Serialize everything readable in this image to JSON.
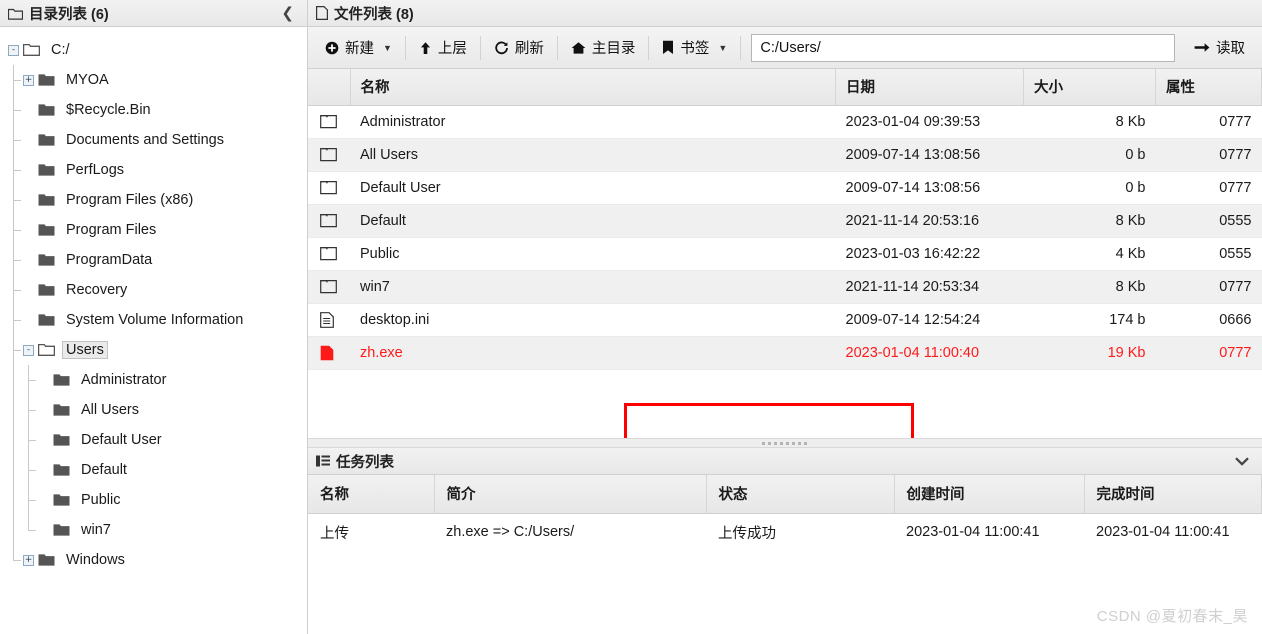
{
  "sidebar": {
    "header": {
      "icon": "folder-outline-icon",
      "title": "目录列表 (6)",
      "collapse_label": "❮"
    },
    "tree": [
      {
        "label": "C:/",
        "depth": 0,
        "toggle": "-",
        "folder": "open",
        "selected": false
      },
      {
        "label": "MYOA",
        "depth": 1,
        "toggle": "+",
        "folder": "closed",
        "selected": false
      },
      {
        "label": "$Recycle.Bin",
        "depth": 1,
        "toggle": "",
        "folder": "closed",
        "selected": false
      },
      {
        "label": "Documents and Settings",
        "depth": 1,
        "toggle": "",
        "folder": "closed",
        "selected": false
      },
      {
        "label": "PerfLogs",
        "depth": 1,
        "toggle": "",
        "folder": "closed",
        "selected": false
      },
      {
        "label": "Program Files (x86)",
        "depth": 1,
        "toggle": "",
        "folder": "closed",
        "selected": false
      },
      {
        "label": "Program Files",
        "depth": 1,
        "toggle": "",
        "folder": "closed",
        "selected": false
      },
      {
        "label": "ProgramData",
        "depth": 1,
        "toggle": "",
        "folder": "closed",
        "selected": false
      },
      {
        "label": "Recovery",
        "depth": 1,
        "toggle": "",
        "folder": "closed",
        "selected": false
      },
      {
        "label": "System Volume Information",
        "depth": 1,
        "toggle": "",
        "folder": "closed",
        "selected": false
      },
      {
        "label": "Users",
        "depth": 1,
        "toggle": "-",
        "folder": "open",
        "selected": true
      },
      {
        "label": "Administrator",
        "depth": 2,
        "toggle": "",
        "folder": "closed",
        "selected": false
      },
      {
        "label": "All Users",
        "depth": 2,
        "toggle": "",
        "folder": "closed",
        "selected": false
      },
      {
        "label": "Default User",
        "depth": 2,
        "toggle": "",
        "folder": "closed",
        "selected": false
      },
      {
        "label": "Default",
        "depth": 2,
        "toggle": "",
        "folder": "closed",
        "selected": false
      },
      {
        "label": "Public",
        "depth": 2,
        "toggle": "",
        "folder": "closed",
        "selected": false
      },
      {
        "label": "win7",
        "depth": 2,
        "toggle": "",
        "folder": "closed",
        "selected": false
      },
      {
        "label": "Windows",
        "depth": 1,
        "toggle": "+",
        "folder": "closed",
        "selected": false
      }
    ]
  },
  "filepanel": {
    "header": {
      "icon": "file-outline-icon",
      "title": "文件列表 (8)"
    },
    "toolbar": {
      "new_label": "新建",
      "up_label": "上层",
      "refresh_label": "刷新",
      "home_label": "主目录",
      "bookmark_label": "书签",
      "read_label": "读取",
      "address_value": "C:/Users/",
      "address_placeholder": "C:/"
    },
    "columns": [
      "名称",
      "日期",
      "大小",
      "属性"
    ],
    "rows": [
      {
        "icon": "folder-icon",
        "name": "Administrator",
        "date": "2023-01-04 09:39:53",
        "size": "8 Kb",
        "attr": "0777",
        "highlight": false
      },
      {
        "icon": "folder-icon",
        "name": "All Users",
        "date": "2009-07-14 13:08:56",
        "size": "0 b",
        "attr": "0777",
        "highlight": false
      },
      {
        "icon": "folder-icon",
        "name": "Default User",
        "date": "2009-07-14 13:08:56",
        "size": "0 b",
        "attr": "0777",
        "highlight": false
      },
      {
        "icon": "folder-icon",
        "name": "Default",
        "date": "2021-11-14 20:53:16",
        "size": "8 Kb",
        "attr": "0555",
        "highlight": false
      },
      {
        "icon": "folder-icon",
        "name": "Public",
        "date": "2023-01-03 16:42:22",
        "size": "4 Kb",
        "attr": "0555",
        "highlight": false
      },
      {
        "icon": "folder-icon",
        "name": "win7",
        "date": "2021-11-14 20:53:34",
        "size": "8 Kb",
        "attr": "0777",
        "highlight": false
      },
      {
        "icon": "file-icon",
        "name": "desktop.ini",
        "date": "2009-07-14 12:54:24",
        "size": "174 b",
        "attr": "0666",
        "highlight": false
      },
      {
        "icon": "file-red-icon",
        "name": "zh.exe",
        "date": "2023-01-04 11:00:40",
        "size": "19 Kb",
        "attr": "0777",
        "highlight": true
      }
    ]
  },
  "taskpanel": {
    "header": {
      "icon": "list-icon",
      "title": "任务列表",
      "collapse_label": "❯"
    },
    "columns": [
      "名称",
      "简介",
      "状态",
      "创建时间",
      "完成时间"
    ],
    "rows": [
      {
        "name": "上传",
        "desc": "zh.exe => C:/Users/",
        "status": "上传成功",
        "created": "2023-01-04 11:00:41",
        "finished": "2023-01-04 11:00:41"
      }
    ]
  },
  "watermark": {
    "text": "CSDN @夏初春末_昊"
  },
  "colors": {
    "accent_red": "#ff1a1a",
    "success_green": "#008800",
    "annotation": "#ff0000"
  }
}
